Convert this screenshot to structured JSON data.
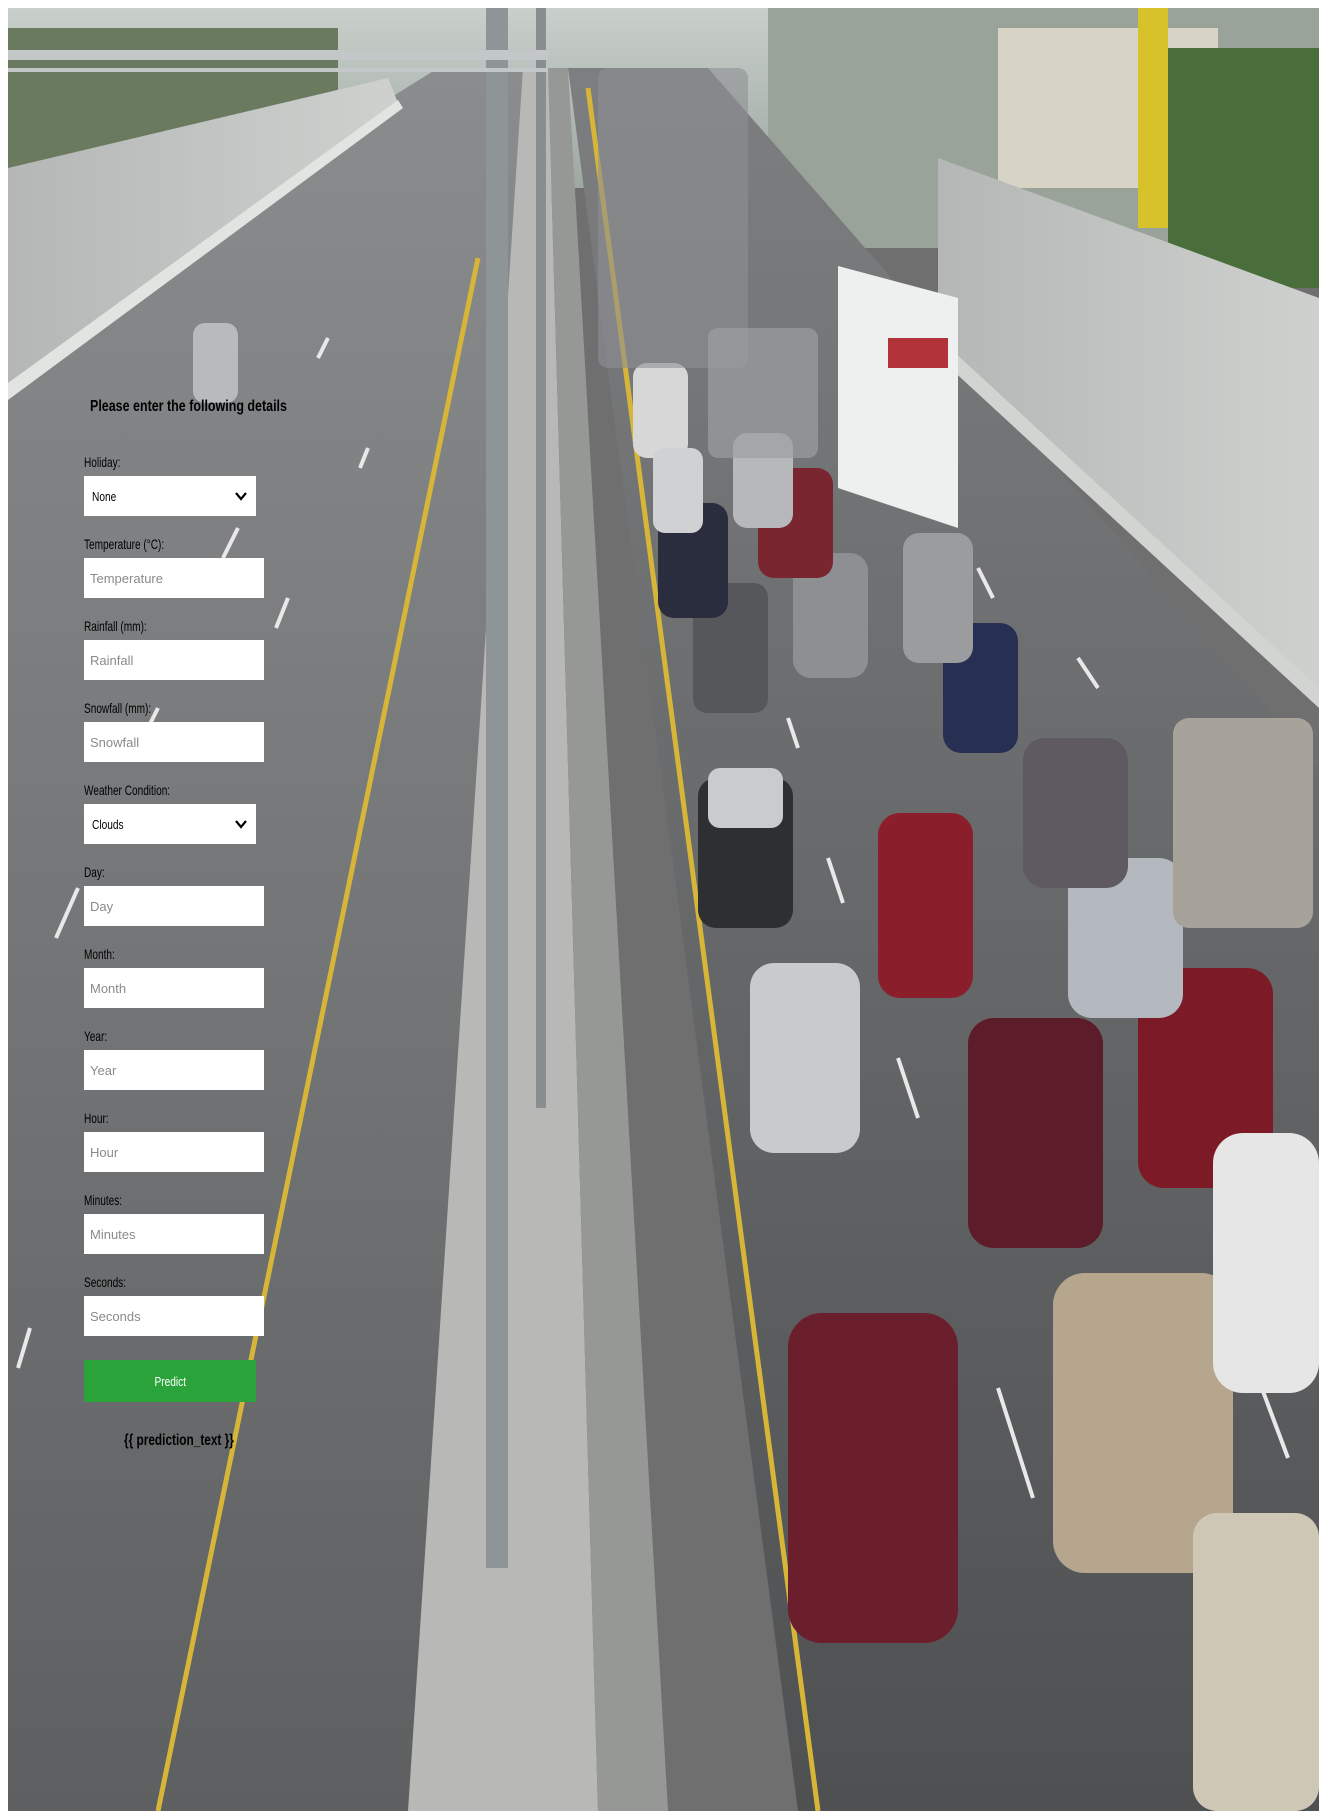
{
  "form": {
    "title": "Please enter the following details",
    "holiday": {
      "label": "Holiday:",
      "value": "None"
    },
    "temperature": {
      "label": "Temperature (°C):",
      "placeholder": "Temperature"
    },
    "rainfall": {
      "label": "Rainfall (mm):",
      "placeholder": "Rainfall"
    },
    "snowfall": {
      "label": "Snowfall (mm):",
      "placeholder": "Snowfall"
    },
    "weather": {
      "label": "Weather Condition:",
      "value": "Clouds"
    },
    "day": {
      "label": "Day:",
      "placeholder": "Day"
    },
    "month": {
      "label": "Month:",
      "placeholder": "Month"
    },
    "year": {
      "label": "Year:",
      "placeholder": "Year"
    },
    "hour": {
      "label": "Hour:",
      "placeholder": "Hour"
    },
    "minutes": {
      "label": "Minutes:",
      "placeholder": "Minutes"
    },
    "seconds": {
      "label": "Seconds:",
      "placeholder": "Seconds"
    },
    "predict_label": "Predict",
    "prediction_text": "{{ prediction_text }}"
  },
  "colors": {
    "predict_button": "#2aa43a",
    "field_background": "#ffffff"
  },
  "background": {
    "image": "highway-traffic-photo"
  }
}
